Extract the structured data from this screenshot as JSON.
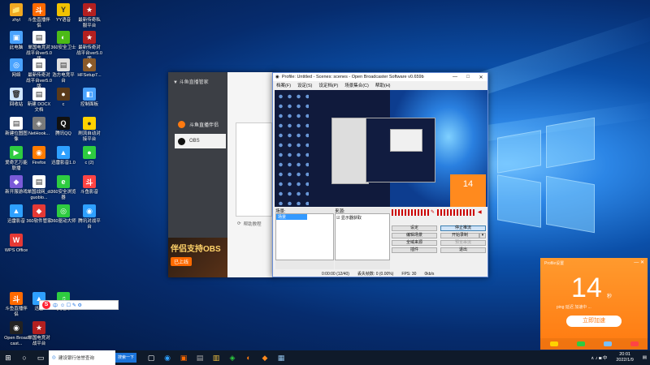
{
  "desktop_icons": [
    {
      "label": "zhyl",
      "color": "#f0a820",
      "glyph": "📁"
    },
    {
      "label": "斗鱼直播伴侣",
      "color": "#ff6a00",
      "glyph": "斗"
    },
    {
      "label": "YY语音",
      "color": "#f2c200",
      "glyph": "Y"
    },
    {
      "label": "最新传奇私服平台",
      "color": "#b32020",
      "glyph": "★"
    },
    {
      "label": "此电脑",
      "color": "#4aa3ff",
      "glyph": "▣"
    },
    {
      "label": "单国电竞对战平台ver5.0版",
      "color": "#ffffff",
      "glyph": "▤"
    },
    {
      "label": "360安全卫士",
      "color": "#4cbb17",
      "glyph": "◐"
    },
    {
      "label": "最新传奇对战平台ver5.0版",
      "color": "#b32020",
      "glyph": "★"
    },
    {
      "label": "网络",
      "color": "#4aa3ff",
      "glyph": "◎"
    },
    {
      "label": "最新传奇对战平台ver5.0版",
      "color": "#ffffff",
      "glyph": "▤"
    },
    {
      "label": "浩方电竞平台",
      "color": "#e0e0e0",
      "glyph": "▤"
    },
    {
      "label": "HFSetup7...",
      "color": "#8a5a2a",
      "glyph": "◆"
    },
    {
      "label": "回收站",
      "color": "#cfe6ff",
      "glyph": "🗑"
    },
    {
      "label": "新建 DOCX 文档",
      "color": "#ffffff",
      "glyph": "▤"
    },
    {
      "label": "c",
      "color": "#5a3a1a",
      "glyph": "●"
    },
    {
      "label": "控制面板",
      "color": "#4aa3ff",
      "glyph": "◧"
    },
    {
      "label": "新建位图图像",
      "color": "#ffffff",
      "glyph": "▤"
    },
    {
      "label": "NetHook...",
      "color": "#7a7a7a",
      "glyph": "◈"
    },
    {
      "label": "腾讯QQ",
      "color": "#111111",
      "glyph": "Q"
    },
    {
      "label": "刷流自动对接平台",
      "color": "#ffd200",
      "glyph": "●"
    },
    {
      "label": "爱奇艺万能联播",
      "color": "#2ecc40",
      "glyph": "▶"
    },
    {
      "label": "Firefox",
      "color": "#ff7b00",
      "glyph": "◉"
    },
    {
      "label": "迅雷影音1.0",
      "color": "#2ea0ff",
      "glyph": "▲"
    },
    {
      "label": "c (2)",
      "color": "#2ecc40",
      "glyph": "●"
    },
    {
      "label": "新开服游戏",
      "color": "#7a5ad8",
      "glyph": "◆"
    },
    {
      "label": "单国战网_diguoblo...",
      "color": "#ffffff",
      "glyph": "▤"
    },
    {
      "label": "360安全浏览器",
      "color": "#2ecc40",
      "glyph": "e"
    },
    {
      "label": "斗鱼影音",
      "color": "#ff4444",
      "glyph": "斗"
    },
    {
      "label": "迅雷影音",
      "color": "#2ea0ff",
      "glyph": "▲"
    },
    {
      "label": "360软件管家",
      "color": "#e53935",
      "glyph": "◆"
    },
    {
      "label": "360驱动大师",
      "color": "#2ecc40",
      "glyph": "◎"
    },
    {
      "label": "腾讯对战平台",
      "color": "#2ea0ff",
      "glyph": "◉"
    },
    {
      "label": "WPS Office",
      "color": "#e53935",
      "glyph": "W"
    },
    {
      "label": "斗鱼直播伴侣",
      "color": "#ff6a00",
      "glyph": "斗"
    },
    {
      "label": "迅雷",
      "color": "#2ea0ff",
      "glyph": "▲"
    },
    {
      "label": "QQ音乐",
      "color": "#2ecc40",
      "glyph": "♫"
    },
    {
      "label": "Open Broadcast...",
      "color": "#222222",
      "glyph": "◉"
    },
    {
      "label": "单国电竞对战平台",
      "color": "#b32020",
      "glyph": "★"
    }
  ],
  "douyu": {
    "title": "斗鱼直播管家",
    "nav": [
      {
        "label": "斗鱼直播伴侣",
        "color": "#ff7a10"
      },
      {
        "label": "OBS",
        "color": "#111111"
      }
    ],
    "banner_title": "伴侣支持OBS",
    "banner_cta": "已上线",
    "help": "帮助教程"
  },
  "obs": {
    "title": "Profile: Untitled - Scenes: scenes - Open Broadcaster Software v0.659b",
    "menu": [
      "档案(F)",
      "设定(S)",
      "设定档(P)",
      "场景集合(C)",
      "帮助(H)"
    ],
    "scenes_label": "场景:",
    "scene_selected": "场景",
    "sources_label": "来源:",
    "source_item": "显示器获取",
    "buttons": {
      "settings": "设定",
      "stop_stream": "停止推流",
      "edit_scene": "编辑场景",
      "start_record": "开始录制",
      "fullscreen": "全域来源",
      "preview": "预览串流",
      "plugins": "插件",
      "exit": "退出"
    },
    "status": {
      "time": "0:00:00 (12/40)",
      "dropped": "丢失帧数: 0 (0.00%)",
      "fps": "FPS: 30",
      "bitrate": "0kb/s"
    },
    "preview_badge": "14"
  },
  "boost": {
    "title": "Profile设置",
    "value": "14",
    "unit": "秒",
    "subtitle": "ping 延迟 加速中 ...",
    "button": "立即加速",
    "footer_colors": [
      "#ffd200",
      "#2ecc40",
      "#7ac0ff",
      "#ff4444"
    ]
  },
  "ime_bar": {
    "logo": "S",
    "mode": "中",
    "icons": "☺ ☐ ✎ ⚙"
  },
  "taskbar": {
    "search_placeholder": "建设银行信誉查询",
    "search_button": "搜索一下",
    "apps": [
      "▢",
      "◉",
      "▣",
      "▤",
      "▥",
      "◈",
      "◐",
      "◆",
      "▦"
    ],
    "tray": "∧ ♪ ◙ 中",
    "time": "20:01",
    "date": "2022/1/9"
  }
}
